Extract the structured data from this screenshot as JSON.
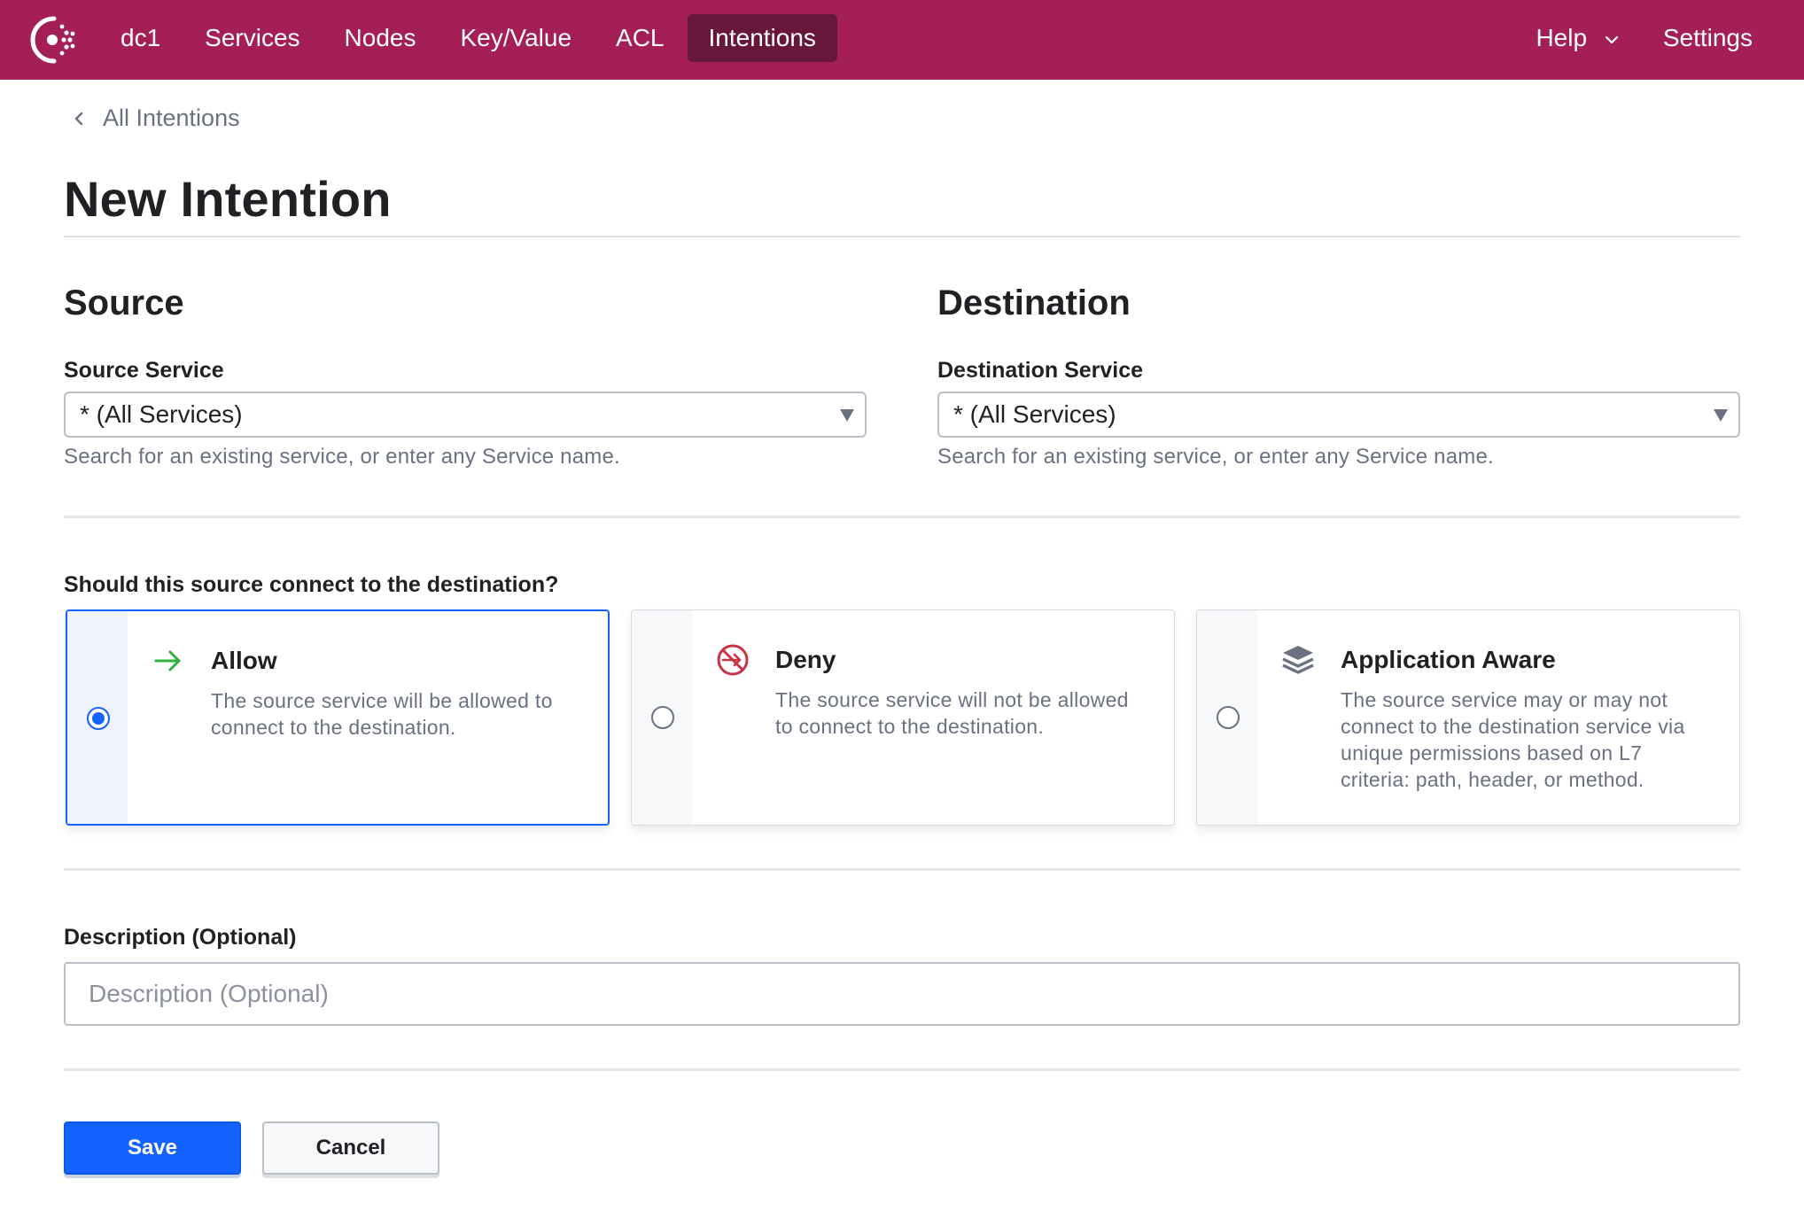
{
  "nav": {
    "datacenter": "dc1",
    "items": [
      {
        "label": "Services"
      },
      {
        "label": "Nodes"
      },
      {
        "label": "Key/Value"
      },
      {
        "label": "ACL"
      },
      {
        "label": "Intentions"
      }
    ],
    "help_label": "Help",
    "settings_label": "Settings",
    "brand_color": "#a31f56",
    "active_color": "#67173a"
  },
  "breadcrumb": {
    "label": "All Intentions"
  },
  "page": {
    "title": "New Intention"
  },
  "source": {
    "title": "Source",
    "field_label": "Source Service",
    "selected_value": "* (All Services)",
    "help": "Search for an existing service, or enter any Service name."
  },
  "destination": {
    "title": "Destination",
    "field_label": "Destination Service",
    "selected_value": "* (All Services)",
    "help": "Search for an existing service, or enter any Service name."
  },
  "action": {
    "question": "Should this source connect to the destination?",
    "options": [
      {
        "title": "Allow",
        "description": "The source service will be allowed to connect to the destination.",
        "icon": "arrow-right-icon",
        "selected": true
      },
      {
        "title": "Deny",
        "description": "The source service will not be allowed to connect to the destination.",
        "icon": "deny-icon",
        "selected": false
      },
      {
        "title": "Application Aware",
        "description": "The source service may or may not connect to the destination service via unique permissions based on L7 criteria: path, header, or method.",
        "icon": "layers-icon",
        "selected": false
      }
    ]
  },
  "description": {
    "label": "Description (Optional)",
    "placeholder": "Description (Optional)",
    "value": ""
  },
  "buttons": {
    "save_label": "Save",
    "cancel_label": "Cancel",
    "primary_color": "#1563ff"
  }
}
